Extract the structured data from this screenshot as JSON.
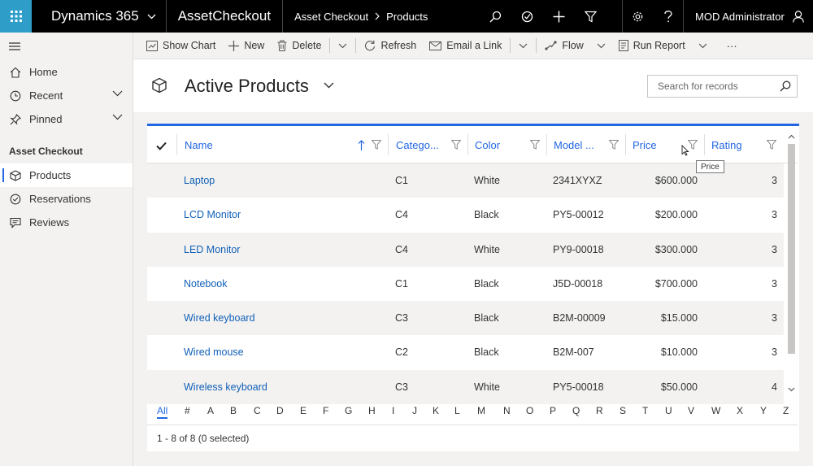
{
  "topbar": {
    "product": "Dynamics 365",
    "app": "AssetCheckout",
    "breadcrumb": [
      "Asset Checkout",
      "Products"
    ],
    "user": "MOD Administrator",
    "icons": [
      "search-icon",
      "assistant-icon",
      "new-icon",
      "filter-icon",
      "settings-icon",
      "help-icon",
      "user-icon"
    ]
  },
  "sidebar": {
    "items": [
      {
        "label": "Home",
        "icon": "home-icon"
      },
      {
        "label": "Recent",
        "icon": "clock-icon"
      },
      {
        "label": "Pinned",
        "icon": "pin-icon"
      }
    ],
    "section": "Asset Checkout",
    "entities": [
      {
        "label": "Products",
        "icon": "cube-icon"
      },
      {
        "label": "Reservations",
        "icon": "check-circle-icon"
      },
      {
        "label": "Reviews",
        "icon": "comment-icon"
      }
    ]
  },
  "commands": {
    "show_chart": "Show Chart",
    "new": "New",
    "delete": "Delete",
    "refresh": "Refresh",
    "email_link": "Email a Link",
    "flow": "Flow",
    "run_report": "Run Report",
    "more": "···"
  },
  "view": {
    "title": "Active Products",
    "search_placeholder": "Search for records"
  },
  "grid": {
    "columns": [
      "Name",
      "Catego...",
      "Color",
      "Model ...",
      "Price",
      "Rating"
    ],
    "tooltip": "Price",
    "rows": [
      {
        "name": "Laptop",
        "category": "C1",
        "color": "White",
        "model": "2341XYXZ",
        "price": "$600.000",
        "rating": "3"
      },
      {
        "name": "LCD Monitor",
        "category": "C4",
        "color": "Black",
        "model": "PY5-00012",
        "price": "$200.000",
        "rating": "3"
      },
      {
        "name": "LED Monitor",
        "category": "C4",
        "color": "White",
        "model": "PY9-00018",
        "price": "$300.000",
        "rating": "3"
      },
      {
        "name": "Notebook",
        "category": "C1",
        "color": "Black",
        "model": "J5D-00018",
        "price": "$700.000",
        "rating": "3"
      },
      {
        "name": "Wired keyboard",
        "category": "C3",
        "color": "Black",
        "model": "B2M-00009",
        "price": "$15.000",
        "rating": "3"
      },
      {
        "name": "Wired mouse",
        "category": "C2",
        "color": "Black",
        "model": "B2M-007",
        "price": "$10.000",
        "rating": "3"
      },
      {
        "name": "Wireless keyboard",
        "category": "C3",
        "color": "White",
        "model": "PY5-00018",
        "price": "$50.000",
        "rating": "4"
      }
    ],
    "jump_letters": [
      "All",
      "#",
      "A",
      "B",
      "C",
      "D",
      "E",
      "F",
      "G",
      "H",
      "I",
      "J",
      "K",
      "L",
      "M",
      "N",
      "O",
      "P",
      "Q",
      "R",
      "S",
      "T",
      "U",
      "V",
      "W",
      "X",
      "Y",
      "Z"
    ],
    "footer": "1 - 8 of 8 (0 selected)"
  },
  "colors": {
    "accent": "#2266e3",
    "waffle": "#2e9ec9",
    "link": "#1160b7",
    "topbar": "#000000"
  }
}
